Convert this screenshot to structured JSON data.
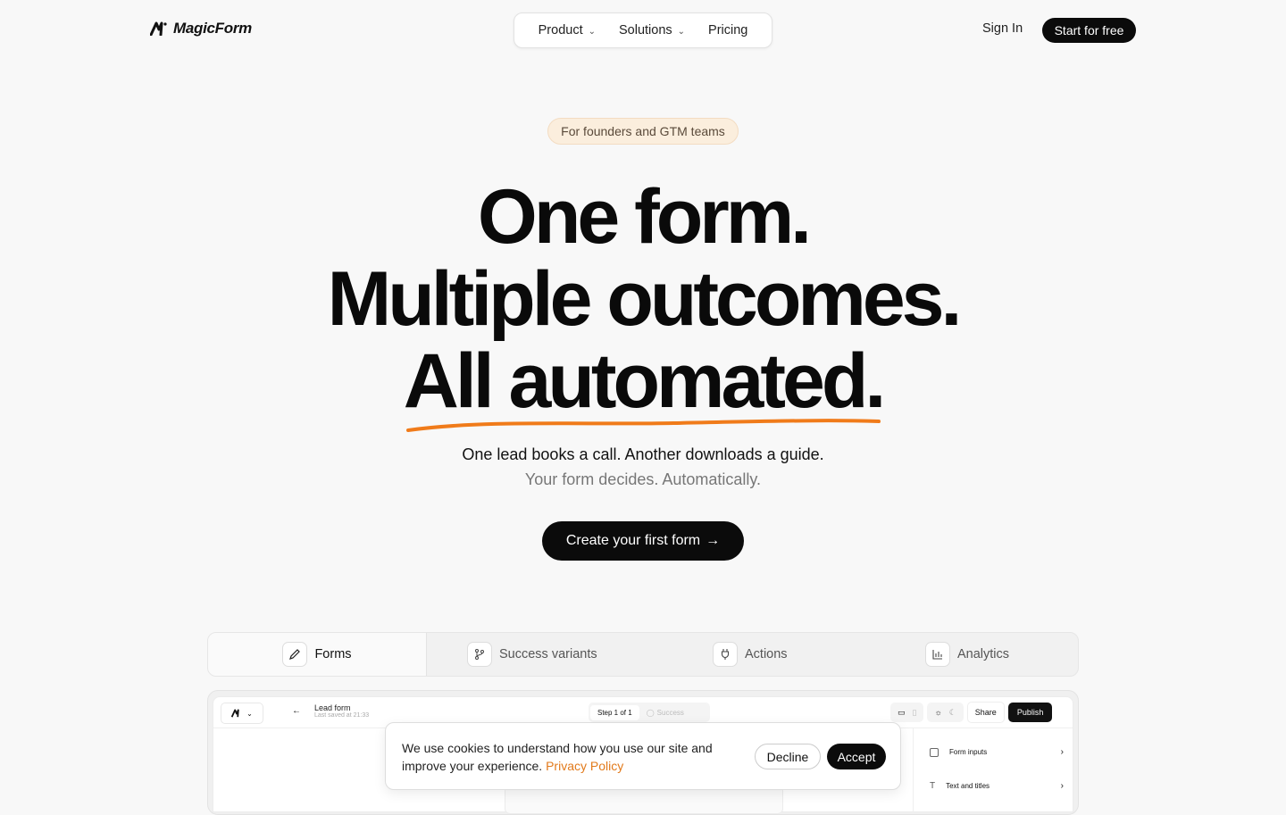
{
  "brand": {
    "name": "MagicForm",
    "accent": "#f07b1a"
  },
  "nav": {
    "items": [
      {
        "label": "Product",
        "has_dropdown": true
      },
      {
        "label": "Solutions",
        "has_dropdown": true
      },
      {
        "label": "Pricing",
        "has_dropdown": false
      }
    ],
    "sign_in": "Sign In",
    "start": "Start for free"
  },
  "hero": {
    "badge": "For founders and GTM teams",
    "line1": "One form.",
    "line2": "Multiple outcomes.",
    "line3": "All automated.",
    "sub1": "One lead books a call. Another downloads a guide.",
    "sub2": "Your form decides. Automatically.",
    "cta": "Create your first form",
    "cta_icon": "arrow-right-icon"
  },
  "tabs": [
    {
      "label": "Forms",
      "icon": "pencil-icon",
      "active": true
    },
    {
      "label": "Success variants",
      "icon": "branch-icon",
      "active": false
    },
    {
      "label": "Actions",
      "icon": "plug-icon",
      "active": false
    },
    {
      "label": "Analytics",
      "icon": "bar-chart-icon",
      "active": false
    }
  ],
  "preview": {
    "form_title": "Lead form",
    "last_saved": "Last saved at 21:33",
    "step": "Step 1 of 1",
    "success": "Success",
    "share": "Share",
    "publish": "Publish",
    "side_items": [
      {
        "label": "Form inputs",
        "icon": "square-icon"
      },
      {
        "label": "Text and titles",
        "icon": "text-icon"
      }
    ]
  },
  "cookie": {
    "text": "We use cookies to understand how you use our site and improve your experience.",
    "link": "Privacy Policy",
    "decline": "Decline",
    "accept": "Accept"
  }
}
